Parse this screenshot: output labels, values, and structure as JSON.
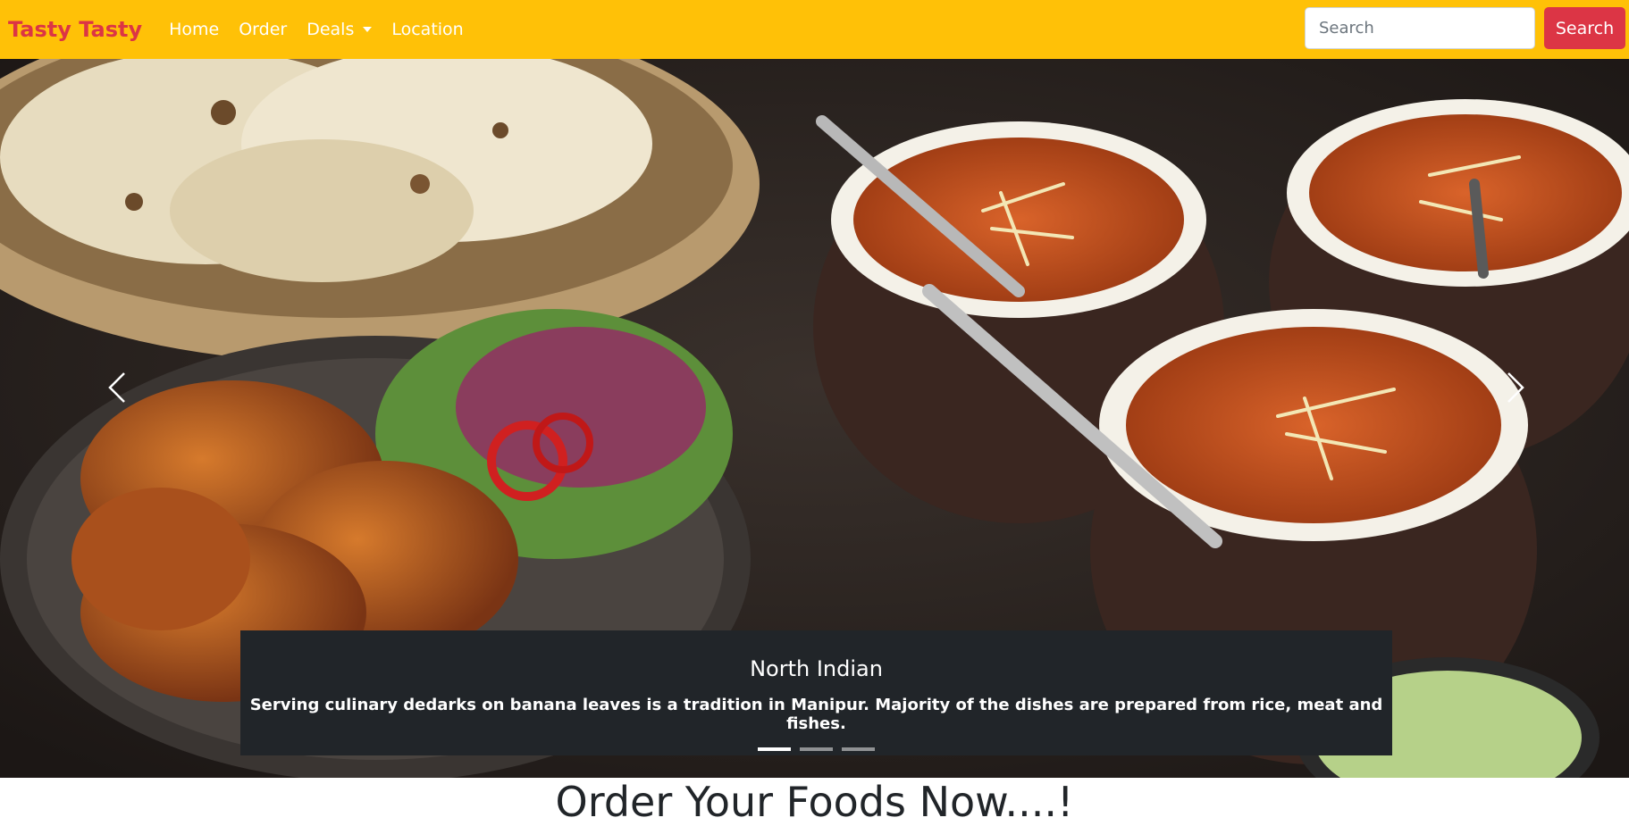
{
  "navbar": {
    "brand": "Tasty Tasty",
    "links": [
      {
        "label": "Home"
      },
      {
        "label": "Order"
      },
      {
        "label": "Deals"
      },
      {
        "label": "Location"
      }
    ],
    "search": {
      "placeholder": "Search",
      "button_label": "Search"
    },
    "colors": {
      "background": "#ffc107",
      "brand": "#dc3545",
      "button": "#dc3545"
    }
  },
  "carousel": {
    "slides": [
      {
        "title": "North Indian",
        "text": "Serving culinary dedarks on banana leaves is a tradition in Manipur. Majority of the dishes are prepared from rice, meat and fishes."
      }
    ],
    "active_index": 0,
    "slide_count": 3,
    "controls": {
      "prev_icon": "chevron-left-icon",
      "next_icon": "chevron-right-icon"
    }
  },
  "main": {
    "heading": "Order Your Foods Now....!"
  }
}
